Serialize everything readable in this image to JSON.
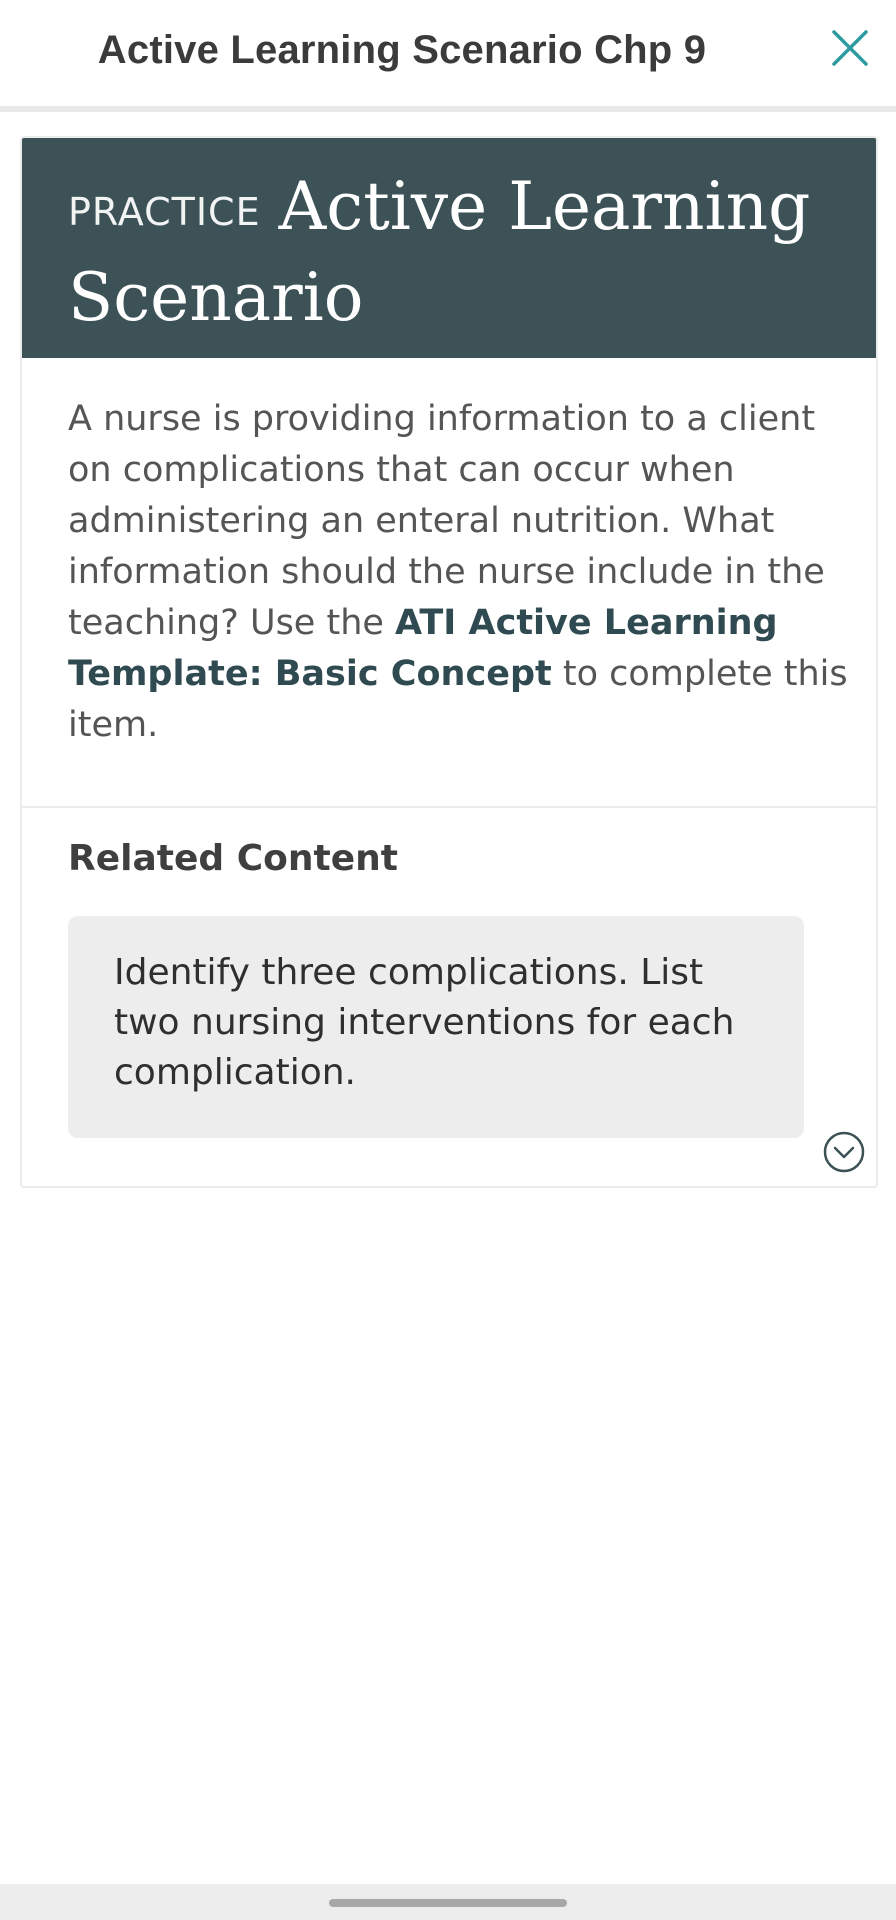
{
  "topbar": {
    "title": "Active Learning Scenario Chp 9",
    "close_icon": "close-icon",
    "accent_color": "#2e9aa0"
  },
  "card": {
    "header_bg_color": "#3c5257",
    "practice_label": "PRACTICE",
    "title_line1": "Active Learning",
    "title_line2": "Scenario",
    "body_part1": "A nurse is providing information to a client on complications that can occur when administering an enteral nutrition. What information should the nurse include in the teaching? Use the ",
    "body_link": "ATI Active Learning Template: Basic Concept",
    "body_part2": " to complete this item.",
    "related_title": "Related Content",
    "related_text": "Identify three complications. List two nursing interventions for each complication.",
    "expand_icon": "chevron-down-circle-icon"
  }
}
